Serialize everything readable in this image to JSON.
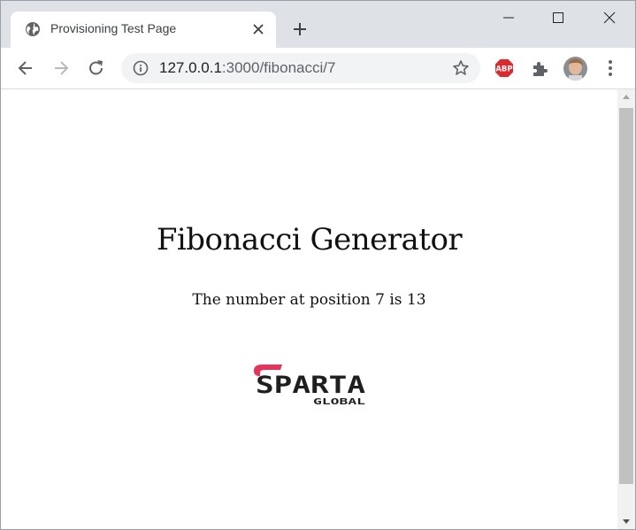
{
  "browser": {
    "tab": {
      "title": "Provisioning Test Page"
    },
    "url": {
      "host": "127.0.0.1",
      "path": ":3000/fibonacci/7"
    },
    "extensions": {
      "abp_label": "ABP"
    }
  },
  "page": {
    "heading": "Fibonacci Generator",
    "result_text": "The number at position 7 is 13",
    "logo": {
      "primary": "SPARTA",
      "secondary": "GLOBAL"
    }
  },
  "colors": {
    "tabstrip": "#dee1e6",
    "omnibox": "#f1f3f4",
    "logo_accent": "#e8325a",
    "abp_red": "#e3262a"
  }
}
